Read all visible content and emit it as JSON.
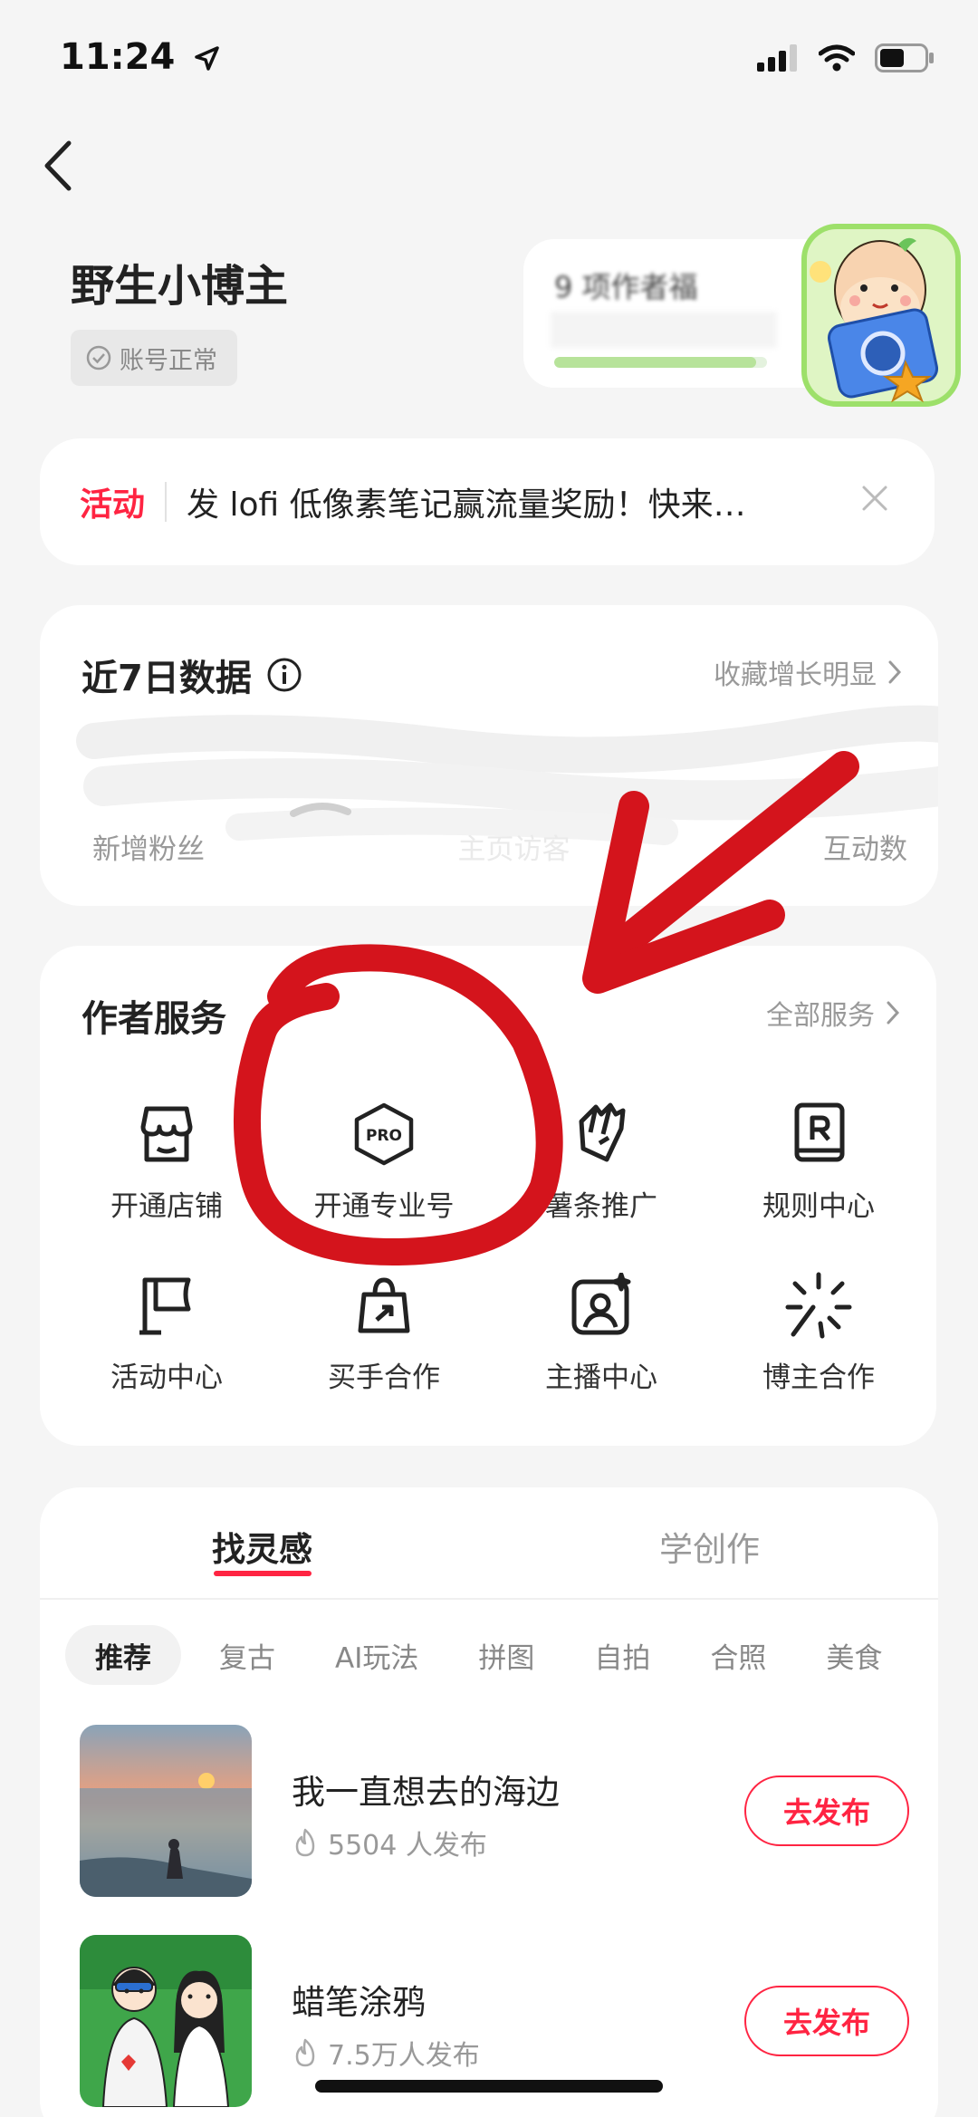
{
  "status_bar": {
    "time": "11:24"
  },
  "profile": {
    "username": "野生小博主",
    "account_status": "账号正常"
  },
  "task_card": {
    "text": "9 项作者福",
    "progress": 0.95
  },
  "activity": {
    "tag": "活动",
    "text": "发 lofi 低像素笔记赢流量奖励！快来…"
  },
  "weekly_data": {
    "title": "近7日数据",
    "link": "收藏增长明显",
    "labels": [
      "新增粉丝",
      "主页访客",
      "互动数"
    ]
  },
  "services": {
    "title": "作者服务",
    "link": "全部服务",
    "items": [
      {
        "label": "开通店铺",
        "icon": "storefront-icon"
      },
      {
        "label": "开通专业号",
        "icon": "pro-badge-icon"
      },
      {
        "label": "薯条推广",
        "icon": "fries-icon"
      },
      {
        "label": "规则中心",
        "icon": "rulebook-icon"
      },
      {
        "label": "活动中心",
        "icon": "flag-icon"
      },
      {
        "label": "买手合作",
        "icon": "shopping-bag-icon"
      },
      {
        "label": "主播中心",
        "icon": "host-icon"
      },
      {
        "label": "博主合作",
        "icon": "sparkle-icon"
      }
    ]
  },
  "inspiration": {
    "tabs": [
      "找灵感",
      "学创作"
    ],
    "chips": [
      "推荐",
      "复古",
      "AI玩法",
      "拼图",
      "自拍",
      "合照",
      "美食"
    ],
    "items": [
      {
        "title": "我一直想去的海边",
        "count": "5504 人发布",
        "button": "去发布"
      },
      {
        "title": "蜡笔涂鸦",
        "count": "7.5万人发布",
        "button": "去发布"
      }
    ]
  },
  "colors": {
    "accent": "#ff2442",
    "annotation": "#d4141c"
  }
}
